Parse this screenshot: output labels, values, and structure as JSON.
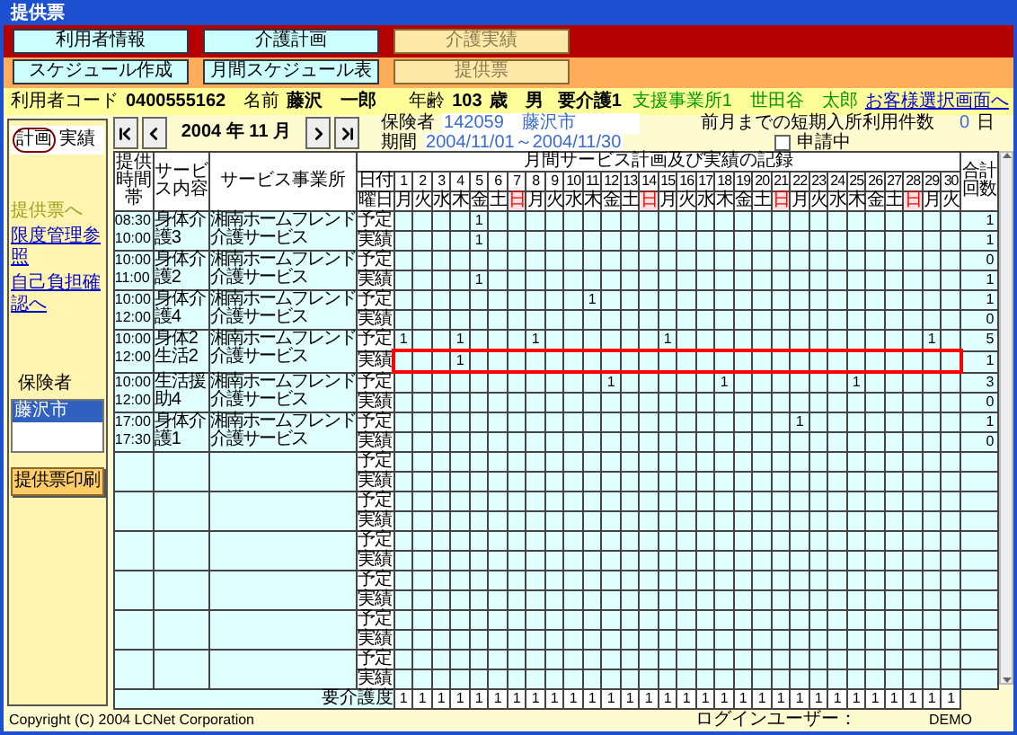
{
  "window": {
    "title": "提供票"
  },
  "menu_rows": [
    {
      "buttons": [
        {
          "label": "利用者情報",
          "selected": false
        },
        {
          "label": "介護計画",
          "selected": false
        },
        {
          "label": "介護実績",
          "selected": true
        }
      ]
    },
    {
      "buttons": [
        {
          "label": "スケジュール作成",
          "selected": false
        },
        {
          "label": "月間スケジュール表",
          "selected": false
        },
        {
          "label": "提供票",
          "selected": true
        }
      ]
    }
  ],
  "user_bar": {
    "code_label": "利用者コード",
    "code": "0400555162",
    "name_label": "名前",
    "name": "藤沢　一郎",
    "age_label": "年齢",
    "age": "103",
    "age_unit": "歳",
    "sex": "男",
    "care_level": "要介護1",
    "office": "支援事業所1",
    "manager": "世田谷　太郎",
    "back_link": "お客様選択画面へ"
  },
  "sidebar": {
    "tabs": [
      {
        "label": "計画",
        "selected": true
      },
      {
        "label": "実績",
        "selected": false
      }
    ],
    "links": [
      {
        "label": "提供票へ",
        "disabled": true
      },
      {
        "label": "限度管理参照",
        "disabled": false
      },
      {
        "label": "自己負担確認へ",
        "disabled": false
      }
    ],
    "insurer_label": "保険者",
    "insurer_list": [
      {
        "label": "藤沢市",
        "selected": true
      }
    ],
    "print_button": "提供票印刷"
  },
  "month_nav": {
    "month": "2004 年 11 月"
  },
  "insurer": {
    "label": "保険者",
    "number": "142059",
    "name": "藤沢市"
  },
  "period": {
    "label": "期間",
    "value": "2004/11/01～2004/11/30"
  },
  "short_stay": {
    "label": "前月までの短期入所利用件数",
    "value": "0",
    "unit": "日"
  },
  "applying": {
    "label": "申請中",
    "checked": false
  },
  "schedule": {
    "title": "月間サービス計画及び実績の記録",
    "headers": {
      "time": "提供時間帯",
      "service": "サービス内容",
      "provider": "サービス事業所",
      "date": "日付",
      "weekday": "曜日",
      "total": "合計回数"
    },
    "days": [
      {
        "date": "1",
        "weekday": "月",
        "holiday": false
      },
      {
        "date": "2",
        "weekday": "火",
        "holiday": false
      },
      {
        "date": "3",
        "weekday": "水",
        "holiday": false
      },
      {
        "date": "4",
        "weekday": "木",
        "holiday": false
      },
      {
        "date": "5",
        "weekday": "金",
        "holiday": false
      },
      {
        "date": "6",
        "weekday": "土",
        "holiday": false
      },
      {
        "date": "7",
        "weekday": "日",
        "holiday": true
      },
      {
        "date": "8",
        "weekday": "月",
        "holiday": false
      },
      {
        "date": "9",
        "weekday": "火",
        "holiday": false
      },
      {
        "date": "10",
        "weekday": "水",
        "holiday": false
      },
      {
        "date": "11",
        "weekday": "木",
        "holiday": false
      },
      {
        "date": "12",
        "weekday": "金",
        "holiday": false
      },
      {
        "date": "13",
        "weekday": "土",
        "holiday": false
      },
      {
        "date": "14",
        "weekday": "日",
        "holiday": true
      },
      {
        "date": "15",
        "weekday": "月",
        "holiday": false
      },
      {
        "date": "16",
        "weekday": "火",
        "holiday": false
      },
      {
        "date": "17",
        "weekday": "水",
        "holiday": false
      },
      {
        "date": "18",
        "weekday": "木",
        "holiday": false
      },
      {
        "date": "19",
        "weekday": "金",
        "holiday": false
      },
      {
        "date": "20",
        "weekday": "土",
        "holiday": false
      },
      {
        "date": "21",
        "weekday": "日",
        "holiday": true
      },
      {
        "date": "22",
        "weekday": "月",
        "holiday": false
      },
      {
        "date": "23",
        "weekday": "火",
        "holiday": false
      },
      {
        "date": "24",
        "weekday": "水",
        "holiday": false
      },
      {
        "date": "25",
        "weekday": "木",
        "holiday": false
      },
      {
        "date": "26",
        "weekday": "金",
        "holiday": false
      },
      {
        "date": "27",
        "weekday": "土",
        "holiday": false
      },
      {
        "date": "28",
        "weekday": "日",
        "holiday": true
      },
      {
        "date": "29",
        "weekday": "月",
        "holiday": false
      },
      {
        "date": "30",
        "weekday": "火",
        "holiday": false
      }
    ],
    "services": [
      {
        "time_start": "08:30",
        "time_end": "10:00",
        "service": "身体介護3",
        "provider": "湘南ホームフレンド介護サービス",
        "rows": [
          {
            "label": "予定",
            "selected": false,
            "total": "1",
            "cells": [
              null,
              null,
              null,
              null,
              "1",
              null,
              null,
              null,
              null,
              null,
              null,
              null,
              null,
              null,
              null,
              null,
              null,
              null,
              null,
              null,
              null,
              null,
              null,
              null,
              null,
              null,
              null,
              null,
              null,
              null
            ]
          },
          {
            "label": "実績",
            "selected": false,
            "total": "1",
            "cells": [
              null,
              null,
              null,
              null,
              "1",
              null,
              null,
              null,
              null,
              null,
              null,
              null,
              null,
              null,
              null,
              null,
              null,
              null,
              null,
              null,
              null,
              null,
              null,
              null,
              null,
              null,
              null,
              null,
              null,
              null
            ]
          }
        ]
      },
      {
        "time_start": "10:00",
        "time_end": "11:00",
        "service": "身体介護2",
        "provider": "湘南ホームフレンド介護サービス",
        "rows": [
          {
            "label": "予定",
            "selected": false,
            "total": "0"
          },
          {
            "label": "実績",
            "selected": false,
            "total": "1",
            "cells": [
              null,
              null,
              null,
              null,
              "1",
              null,
              null,
              null,
              null,
              null,
              null,
              null,
              null,
              null,
              null,
              null,
              null,
              null,
              null,
              null,
              null,
              null,
              null,
              null,
              null,
              null,
              null,
              null,
              null,
              null
            ]
          }
        ]
      },
      {
        "time_start": "10:00",
        "time_end": "12:00",
        "service": "身体介護4",
        "provider": "湘南ホームフレンド介護サービス",
        "rows": [
          {
            "label": "予定",
            "selected": false,
            "total": "1",
            "cells": [
              null,
              null,
              null,
              null,
              null,
              null,
              null,
              null,
              null,
              null,
              "1",
              null,
              null,
              null,
              null,
              null,
              null,
              null,
              null,
              null,
              null,
              null,
              null,
              null,
              null,
              null,
              null,
              null,
              null,
              null
            ]
          },
          {
            "label": "実績",
            "selected": false,
            "total": "0"
          }
        ]
      },
      {
        "time_start": "10:00",
        "time_end": "12:00",
        "service": "身体2生活2",
        "provider": "湘南ホームフレンド介護サービス",
        "rows": [
          {
            "label": "予定",
            "selected": false,
            "total": "5",
            "cells": [
              "1",
              null,
              null,
              "1",
              null,
              null,
              null,
              "1",
              null,
              null,
              null,
              null,
              null,
              null,
              "1",
              null,
              null,
              null,
              null,
              null,
              null,
              null,
              null,
              null,
              null,
              null,
              null,
              null,
              "1",
              null
            ]
          },
          {
            "label": "実績",
            "selected": true,
            "total": "1",
            "cells": [
              null,
              null,
              null,
              "1",
              null,
              null,
              null,
              null,
              null,
              null,
              null,
              null,
              null,
              null,
              null,
              null,
              null,
              null,
              null,
              null,
              null,
              null,
              null,
              null,
              null,
              null,
              null,
              null,
              null,
              null
            ]
          }
        ]
      },
      {
        "time_start": "10:00",
        "time_end": "12:00",
        "service": "生活援助4",
        "provider": "湘南ホームフレンド介護サービス",
        "rows": [
          {
            "label": "予定",
            "selected": false,
            "total": "3",
            "cells": [
              null,
              null,
              null,
              null,
              null,
              null,
              null,
              null,
              null,
              null,
              null,
              "1",
              null,
              null,
              null,
              null,
              null,
              "1",
              null,
              null,
              null,
              null,
              null,
              null,
              "1",
              null,
              null,
              null,
              null,
              null
            ]
          },
          {
            "label": "実績",
            "selected": false,
            "total": "0"
          }
        ]
      },
      {
        "time_start": "17:00",
        "time_end": "17:30",
        "service": "身体介護1",
        "provider": "湘南ホームフレンド介護サービス",
        "rows": [
          {
            "label": "予定",
            "selected": false,
            "total": "1",
            "cells": [
              null,
              null,
              null,
              null,
              null,
              null,
              null,
              null,
              null,
              null,
              null,
              null,
              null,
              null,
              null,
              null,
              null,
              null,
              null,
              null,
              null,
              "1",
              null,
              null,
              null,
              null,
              null,
              null,
              null,
              null
            ]
          },
          {
            "label": "実績",
            "selected": false,
            "total": "0"
          }
        ]
      },
      {
        "rows": [
          {
            "label": "予定",
            "selected": false
          },
          {
            "label": "実績",
            "selected": false
          }
        ]
      },
      {
        "rows": [
          {
            "label": "予定",
            "selected": false
          },
          {
            "label": "実績",
            "selected": false
          }
        ]
      },
      {
        "rows": [
          {
            "label": "予定",
            "selected": false
          },
          {
            "label": "実績",
            "selected": false
          }
        ]
      },
      {
        "rows": [
          {
            "label": "予定",
            "selected": false
          },
          {
            "label": "実績",
            "selected": false
          }
        ]
      },
      {
        "rows": [
          {
            "label": "予定",
            "selected": false
          },
          {
            "label": "実績",
            "selected": false
          }
        ]
      },
      {
        "rows": [
          {
            "label": "予定",
            "selected": false
          },
          {
            "label": "実績",
            "selected": false
          }
        ]
      }
    ],
    "care_level": {
      "label": "要介護度",
      "values": [
        "1",
        "1",
        "1",
        "1",
        "1",
        "1",
        "1",
        "1",
        "1",
        "1",
        "1",
        "1",
        "1",
        "1",
        "1",
        "1",
        "1",
        "1",
        "1",
        "1",
        "1",
        "1",
        "1",
        "1",
        "1",
        "1",
        "1",
        "1",
        "1",
        "1"
      ]
    }
  },
  "footer": {
    "copyright": "Copyright (C) 2004 LCNet Corporation",
    "login_label": "ログインユーザー：",
    "login_user": "DEMO"
  }
}
